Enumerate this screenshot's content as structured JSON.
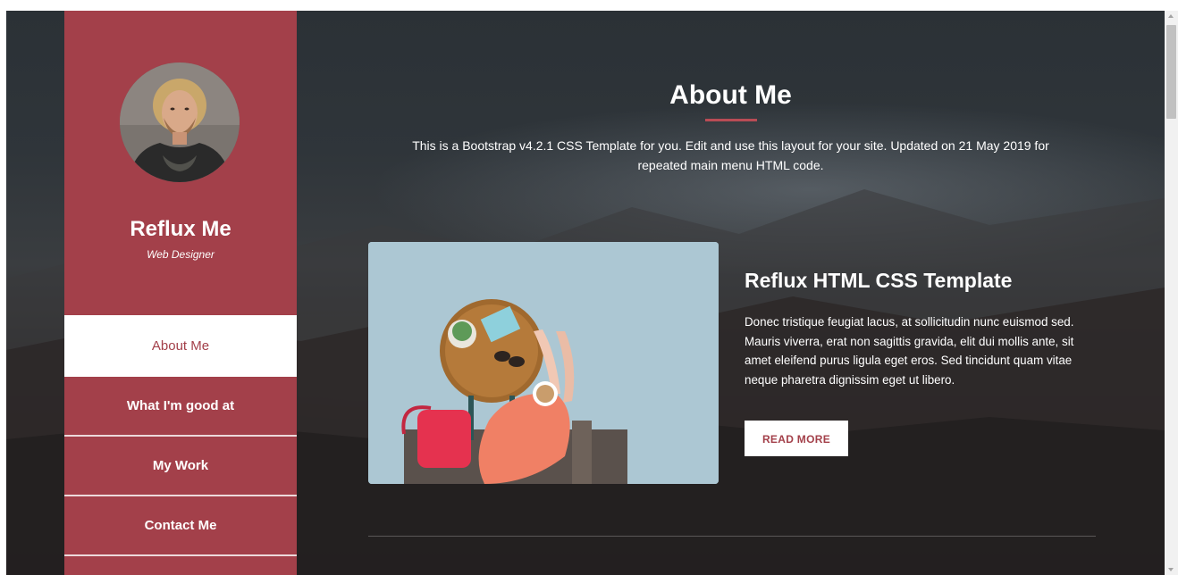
{
  "profile": {
    "name": "Reflux Me",
    "role": "Web Designer"
  },
  "nav": {
    "items": [
      {
        "label": "About Me",
        "active": true
      },
      {
        "label": "What I'm good at",
        "active": false
      },
      {
        "label": "My Work",
        "active": false
      },
      {
        "label": "Contact Me",
        "active": false
      }
    ]
  },
  "section": {
    "title": "About Me",
    "description": "This is a Bootstrap v4.2.1 CSS Template for you. Edit and use this layout for your site. Updated on 21 May 2019 for repeated main menu HTML code."
  },
  "card": {
    "title": "Reflux HTML CSS Template",
    "text": "Donec tristique feugiat lacus, at sollicitudin nunc euismod sed. Mauris viverra, erat non sagittis gravida, elit dui mollis ante, sit amet eleifend purus ligula eget eros. Sed tincidunt quam vitae neque pharetra dignissim eget ut libero.",
    "button_label": "READ MORE"
  },
  "colors": {
    "accent": "#a3404a",
    "accent_rule": "#b94c55",
    "text_light": "#ffffff"
  }
}
